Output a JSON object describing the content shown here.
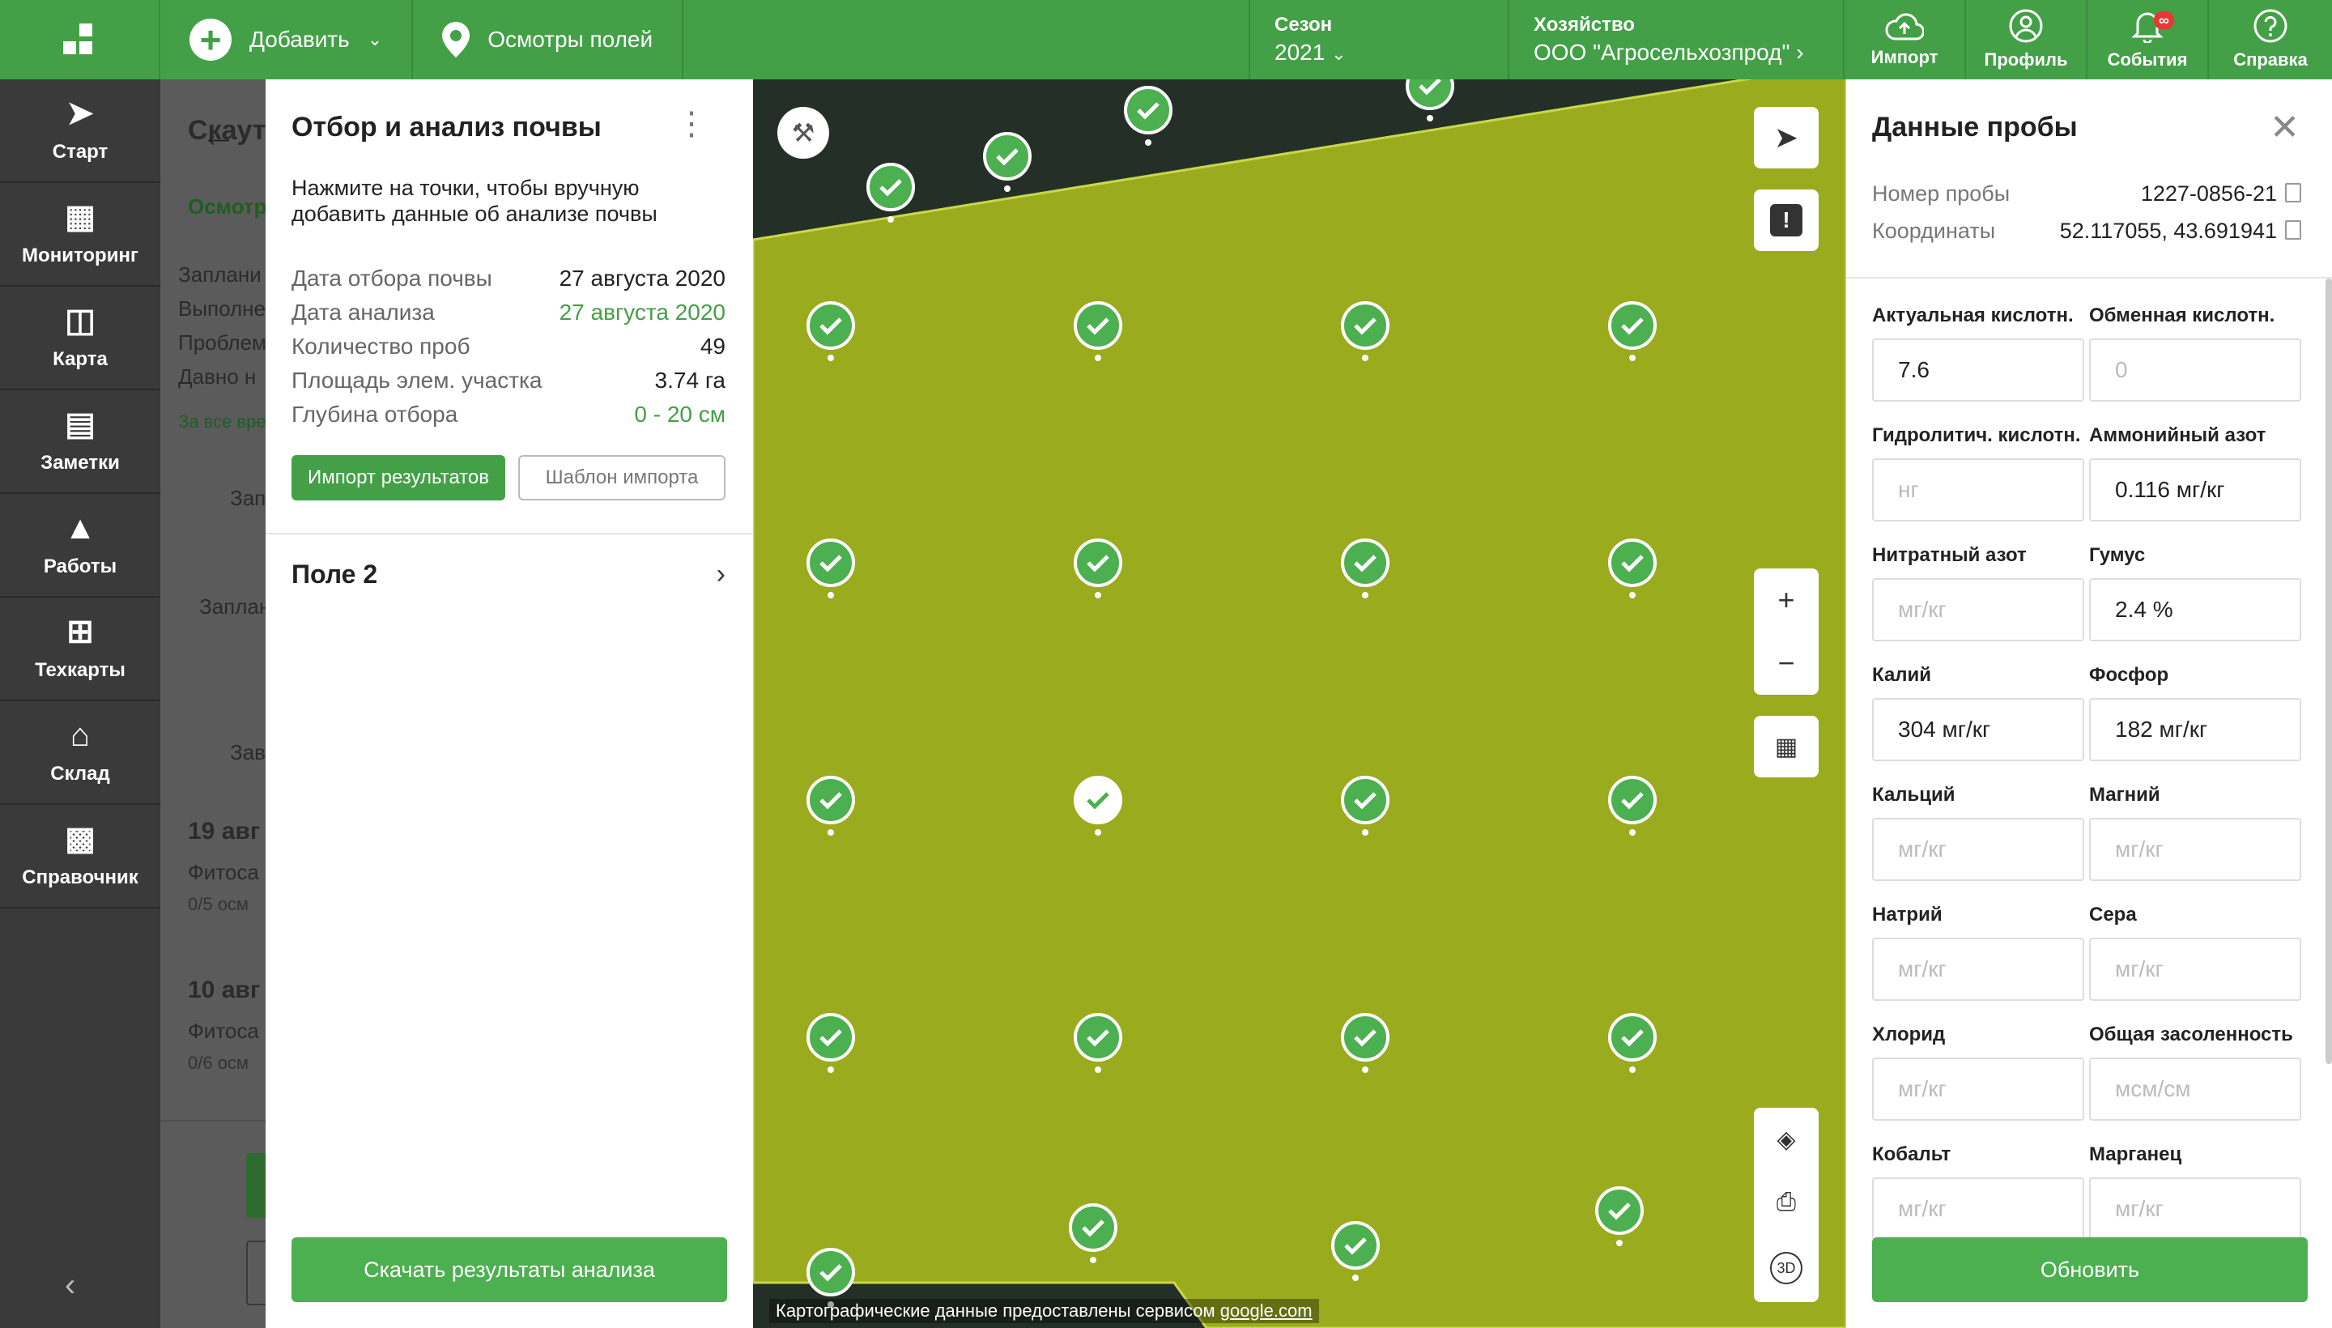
{
  "topbar": {
    "add_label": "Добавить",
    "inspections_label": "Осмотры полей",
    "season_title": "Сезон",
    "season_value": "2021",
    "farm_title": "Хозяйство",
    "farm_value": "ООО \"Агросельхозпрод\"",
    "import_label": "Импорт",
    "profile_label": "Профиль",
    "events_label": "События",
    "events_badge": "∞",
    "help_label": "Справка",
    "accent_color": "#43a047"
  },
  "leftnav": {
    "items": [
      {
        "label": "Старт",
        "icon": "rocket-icon"
      },
      {
        "label": "Мониторинг",
        "icon": "chart-icon"
      },
      {
        "label": "Карта",
        "icon": "map-icon"
      },
      {
        "label": "Заметки",
        "icon": "note-icon"
      },
      {
        "label": "Работы",
        "icon": "tractor-icon"
      },
      {
        "label": "Техкарты",
        "icon": "grid-icon"
      },
      {
        "label": "Склад",
        "icon": "warehouse-icon"
      },
      {
        "label": "Справочник",
        "icon": "book-icon"
      }
    ]
  },
  "behind": {
    "title": "Скаут",
    "tab": "Осмотр",
    "lines": [
      "Заплани",
      "Выполне",
      "Проблем",
      "Давно н"
    ],
    "all_time": "За все вре",
    "group1": "Запл",
    "planned": "Заплан",
    "group2": "Зав",
    "date1": "19 авг",
    "phyto1": "Фитоса",
    "count1": "0/5 осм",
    "date2": "10 авг",
    "phyto2": "Фитоса",
    "count2": "0/6 осм"
  },
  "panel": {
    "title": "Отбор и анализ почвы",
    "description": "Нажмите на точки, чтобы вручную добавить данные об анализе почвы",
    "info": [
      {
        "key": "Дата отбора почвы",
        "value": "27 августа 2020",
        "green": false
      },
      {
        "key": "Дата анализа",
        "value": "27 августа 2020",
        "green": true
      },
      {
        "key": "Количество проб",
        "value": "49",
        "green": false
      },
      {
        "key": "Площадь элем. участка",
        "value": "3.74 га",
        "green": false
      },
      {
        "key": "Глубина отбора",
        "value": "0 - 20 см",
        "green": true
      }
    ],
    "import_button": "Импорт результатов",
    "template_button": "Шаблон импорта",
    "field_name": "Поле 2",
    "download_button": "Скачать результаты анализа"
  },
  "map": {
    "attribution_prefix": "Картографические данные предоставлены сервисом ",
    "attribution_link": "google.com",
    "field_color": "#9aab1e"
  },
  "sample": {
    "title": "Данные пробы",
    "number_label": "Номер пробы",
    "number_value": "1227-0856-21",
    "coords_label": "Координаты",
    "coords_value": "52.117055, 43.691941",
    "fields": [
      {
        "label": "Актуальная кислотн.",
        "value": "7.6",
        "placeholder": ""
      },
      {
        "label": "Обменная кислотн.",
        "value": "",
        "placeholder": "0"
      },
      {
        "label": "Гидролитич. кислотн.",
        "value": "",
        "placeholder": "нг"
      },
      {
        "label": "Аммонийный азот",
        "value": "0.116 мг/кг",
        "placeholder": ""
      },
      {
        "label": "Нитратный азот",
        "value": "",
        "placeholder": "мг/кг"
      },
      {
        "label": "Гумус",
        "value": "2.4 %",
        "placeholder": ""
      },
      {
        "label": "Калий",
        "value": "304 мг/кг",
        "placeholder": ""
      },
      {
        "label": "Фосфор",
        "value": "182 мг/кг",
        "placeholder": ""
      },
      {
        "label": "Кальций",
        "value": "",
        "placeholder": "мг/кг"
      },
      {
        "label": "Магний",
        "value": "",
        "placeholder": "мг/кг"
      },
      {
        "label": "Натрий",
        "value": "",
        "placeholder": "мг/кг"
      },
      {
        "label": "Сера",
        "value": "",
        "placeholder": "мг/кг"
      },
      {
        "label": "Хлорид",
        "value": "",
        "placeholder": "мг/кг"
      },
      {
        "label": "Общая засоленность",
        "value": "",
        "placeholder": "мсм/см"
      },
      {
        "label": "Кобальт",
        "value": "",
        "placeholder": "мг/кг"
      },
      {
        "label": "Марганец",
        "value": "",
        "placeholder": "мг/кг"
      }
    ],
    "update_button": "Обновить"
  }
}
